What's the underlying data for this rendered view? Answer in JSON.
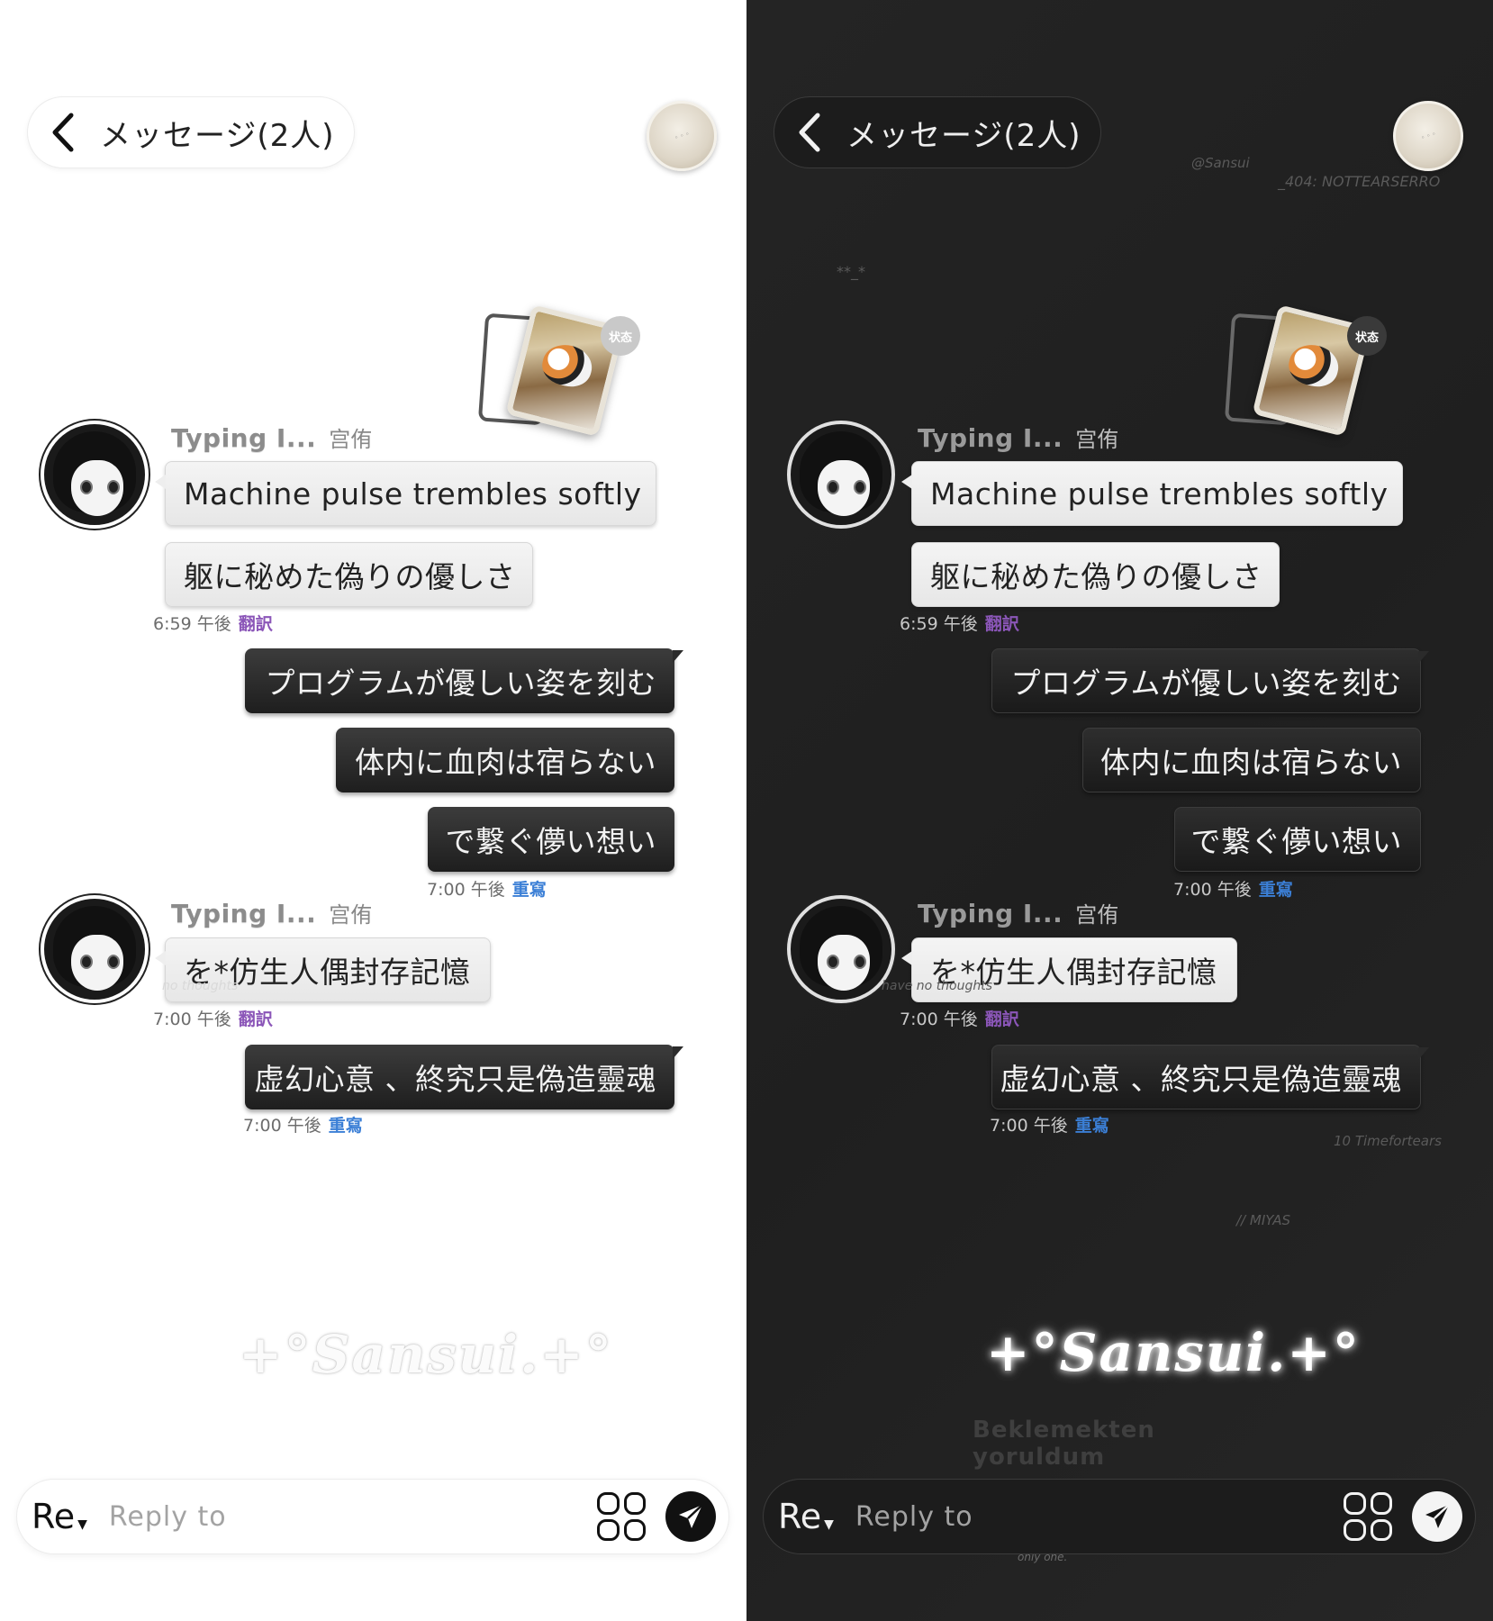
{
  "header": {
    "back_label": "メッセージ(2人)"
  },
  "status": {
    "badge": "状态"
  },
  "messages": {
    "sender_typing": "Typing I...",
    "sender_name": "宫侑",
    "m1": "Machine pulse trembles softly",
    "m2": "躯に秘めた偽りの優しさ",
    "t1": "6:59 午後",
    "m3": "プログラムが優しい姿を刻む",
    "m4": "体内に血肉は宿らない",
    "m5": "で繋ぐ儚い想い",
    "t2": "7:00 午後",
    "m6": "を*仿生人偶封存記憶",
    "t3": "7:00 午後",
    "m7": "虚幻心意 、終究只是偽造靈魂",
    "t4": "7:00 午後",
    "translate": "翻訳",
    "rewrite": "重寫"
  },
  "decorations": {
    "watermark": "+°Sansui.+°",
    "at_sansui": "@Sansui",
    "notears": "_404: NOTTEARSERRO",
    "stars": "**_*",
    "timeforte": "10 Timefortears",
    "miyas": "// MIYAS",
    "no_thoughts": "have no thoughts",
    "no_thoughts_light": "no thoughts",
    "sub_watermark": "Beklemekten yoruldum",
    "love_line": "Love has no definition, but you are the only one."
  },
  "input": {
    "re_label": "Re",
    "placeholder": "Reply to"
  },
  "colors": {
    "translate": "#8b56b8",
    "rewrite": "#3b7fd6"
  }
}
